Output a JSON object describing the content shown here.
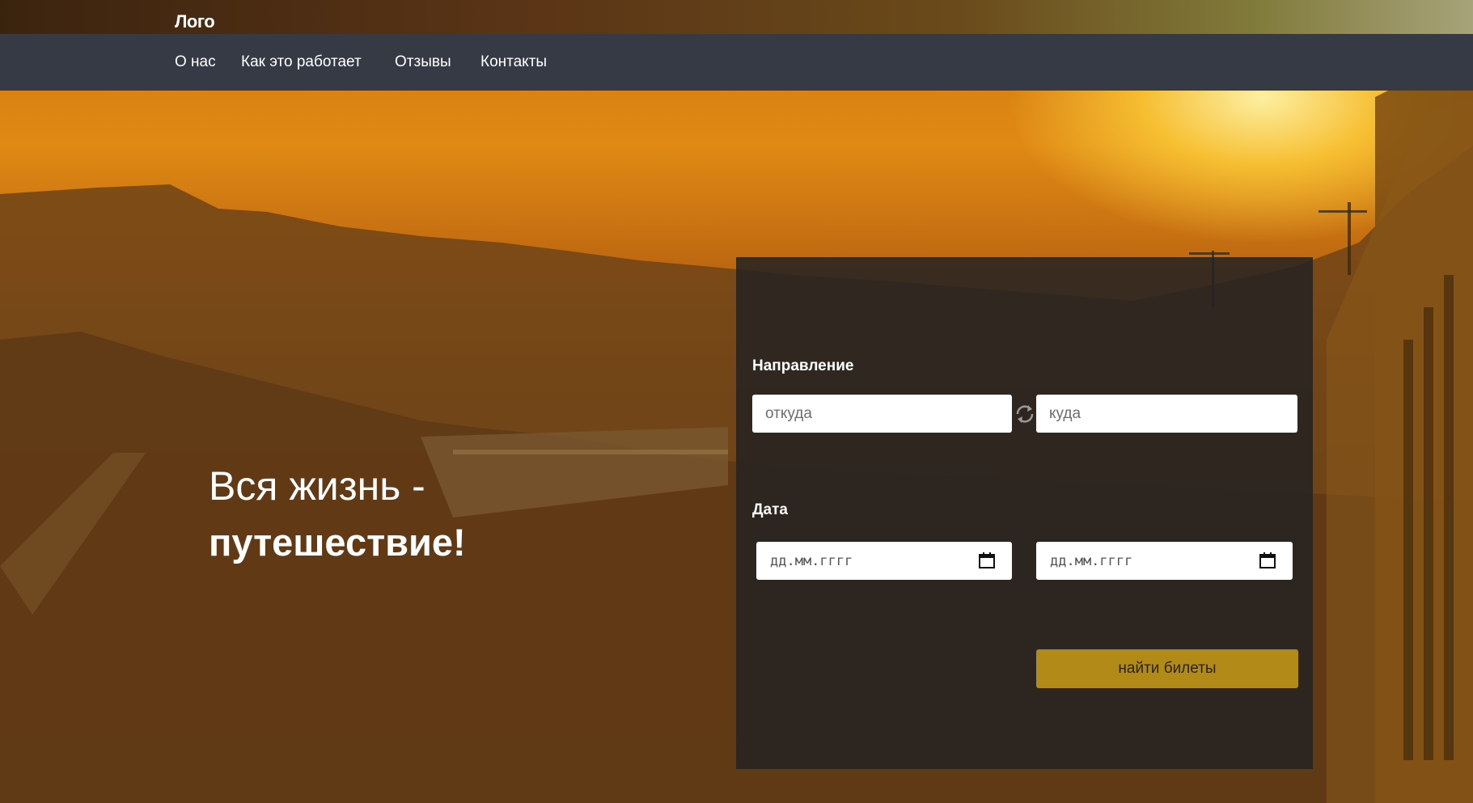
{
  "header": {
    "logo": "Лого"
  },
  "nav": {
    "items": [
      {
        "label": "О нас"
      },
      {
        "label": "Как это работает"
      },
      {
        "label": "Отзывы"
      },
      {
        "label": "Контакты"
      }
    ]
  },
  "hero": {
    "line1": "Вся жизнь -",
    "line2": "путешествие!"
  },
  "search": {
    "direction_label": "Направление",
    "from_placeholder": "откуда",
    "to_placeholder": "куда",
    "date_label": "Дата",
    "date_from_placeholder": "дд.мм.гггг",
    "date_to_placeholder": "дд.мм.гггг",
    "submit_label": "найти билеты",
    "swap_icon": "swap-arrows-icon",
    "calendar_icon": "calendar-icon"
  },
  "colors": {
    "navbar": "#353a45",
    "panel": "#242222",
    "button": "#b28a18",
    "background_sky": "#e08a14"
  }
}
